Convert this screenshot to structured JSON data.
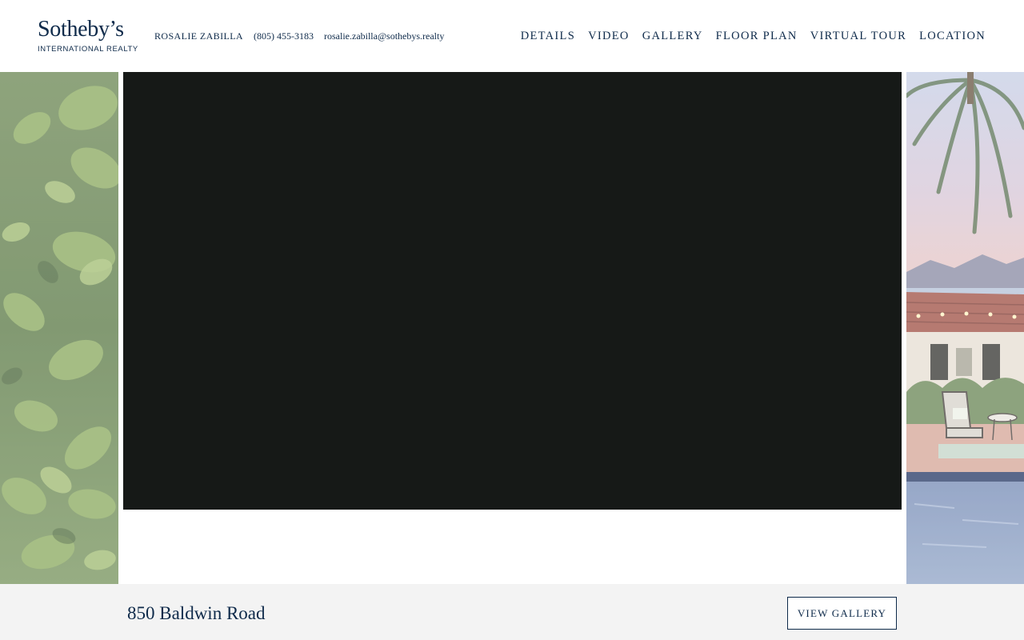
{
  "brand": {
    "name": "Sotheby’s",
    "sub": "INTERNATIONAL REALTY"
  },
  "agent": {
    "name": "ROSALIE ZABILLA",
    "phone": "(805) 455-3183",
    "email": "rosalie.zabilla@sothebys.realty"
  },
  "nav": {
    "items": [
      "DETAILS",
      "VIDEO",
      "GALLERY",
      "FLOOR PLAN",
      "VIRTUAL TOUR",
      "LOCATION"
    ]
  },
  "hero": {
    "left_image": "foliage-photo",
    "right_image": "pool-house-photo",
    "video": "property-video-player"
  },
  "listing": {
    "address": "850 Baldwin Road",
    "gallery_button": "VIEW GALLERY"
  },
  "colors": {
    "brand_navy": "#0e2a4a",
    "video_bg": "#161917",
    "bar_bg": "#f3f3f3"
  }
}
